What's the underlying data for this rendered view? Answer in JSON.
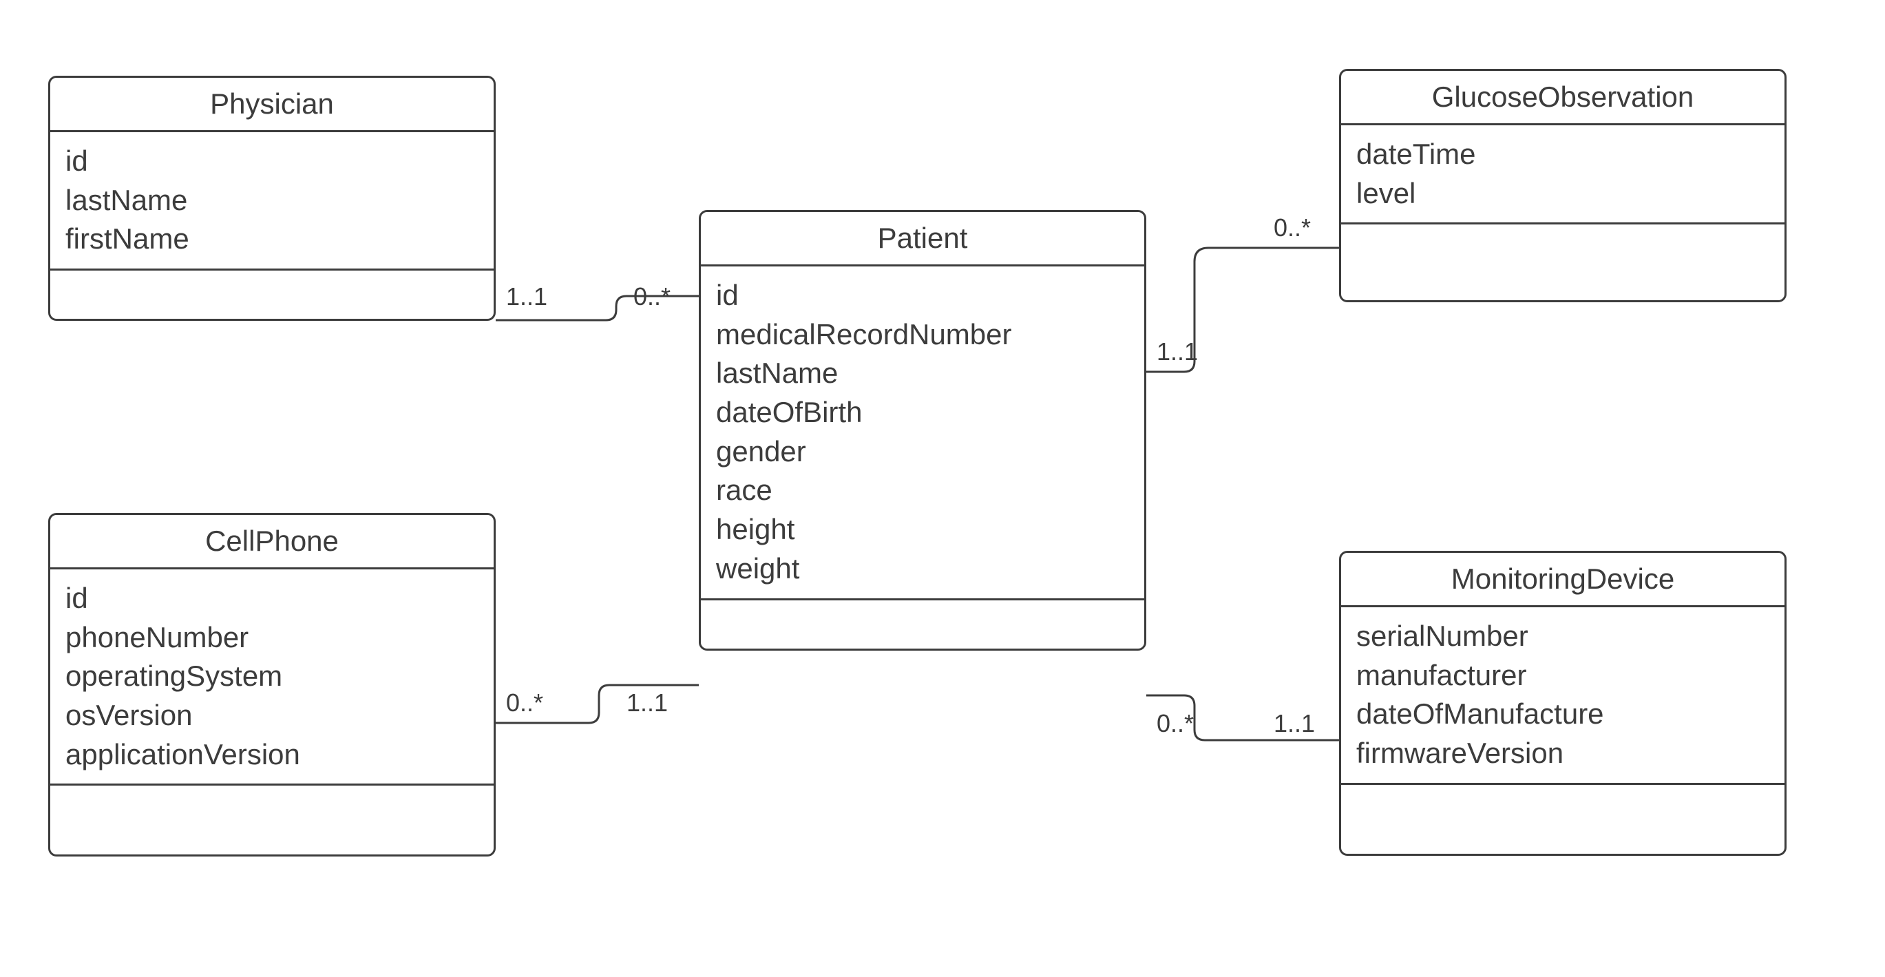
{
  "diagram": {
    "type": "uml-class-diagram",
    "classes": {
      "physician": {
        "name": "Physician",
        "attributes": [
          "id",
          "lastName",
          "firstName"
        ]
      },
      "patient": {
        "name": "Patient",
        "attributes": [
          "id",
          "medicalRecordNumber",
          "lastName",
          "dateOfBirth",
          "gender",
          "race",
          "height",
          "weight"
        ]
      },
      "glucoseObservation": {
        "name": "GlucoseObservation",
        "attributes": [
          "dateTime",
          "level"
        ]
      },
      "cellPhone": {
        "name": "CellPhone",
        "attributes": [
          "id",
          "phoneNumber",
          "operatingSystem",
          "osVersion",
          "applicationVersion"
        ]
      },
      "monitoringDevice": {
        "name": "MonitoringDevice",
        "attributes": [
          "serialNumber",
          "manufacturer",
          "dateOfManufacture",
          "firmwareVersion"
        ]
      }
    },
    "associations": {
      "physicianPatient": {
        "leftMult": "1..1",
        "rightMult": "0..*"
      },
      "patientGlucose": {
        "leftMult": "1..1",
        "rightMult": "0..*"
      },
      "cellphonePatient": {
        "leftMult": "0..*",
        "rightMult": "1..1"
      },
      "patientMonitoring": {
        "leftMult": "0..*",
        "rightMult": "1..1"
      }
    }
  }
}
